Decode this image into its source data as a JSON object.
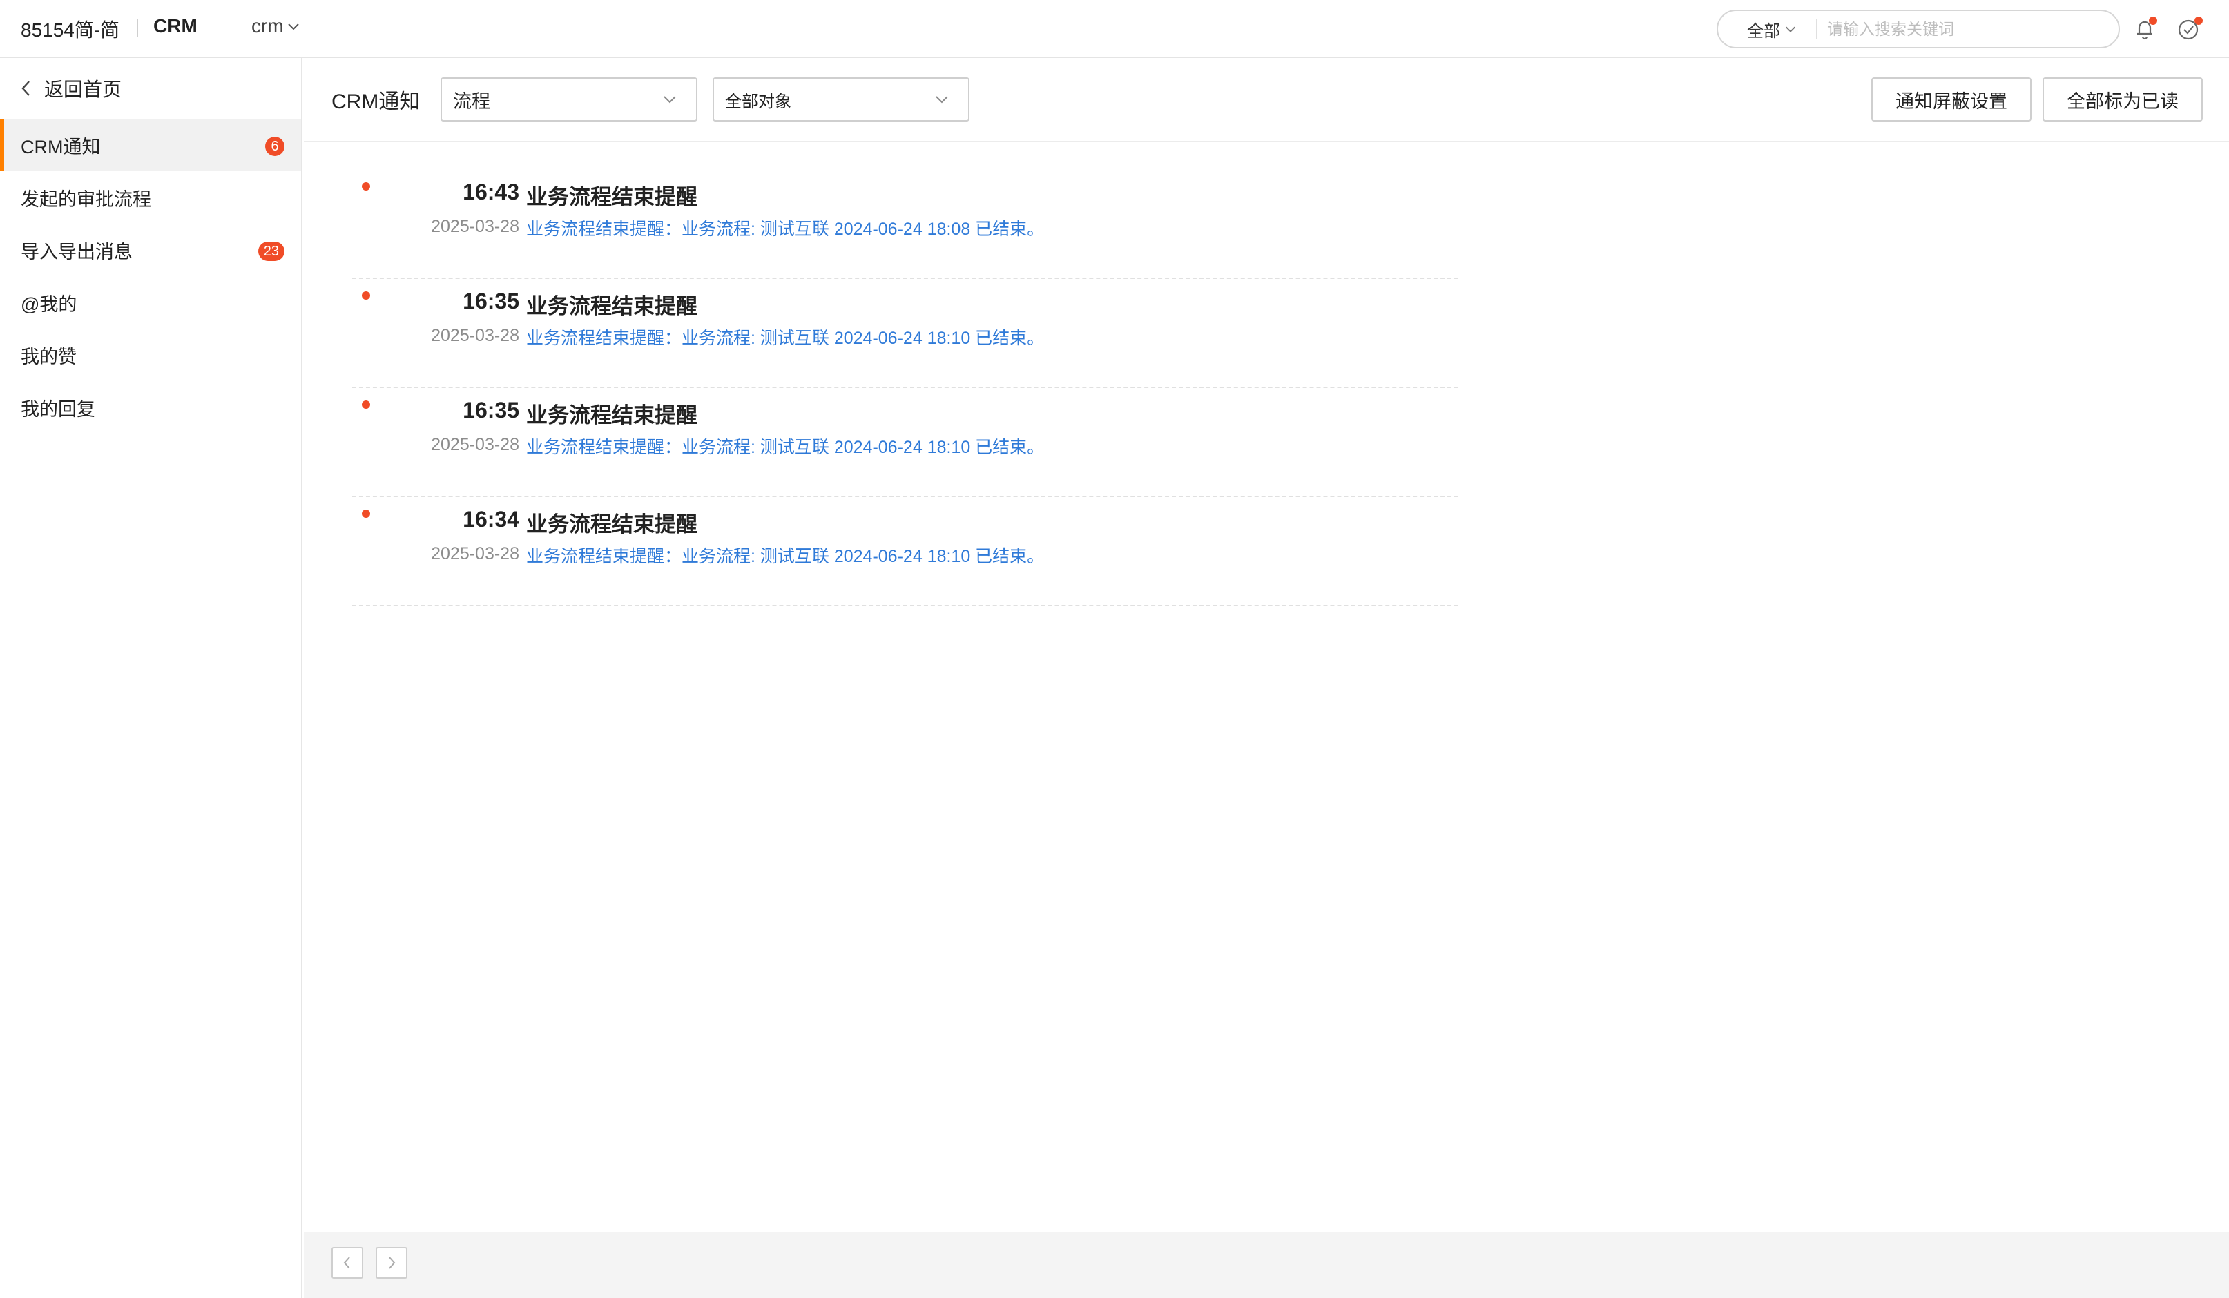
{
  "header": {
    "company": "85154简-简",
    "app_name": "CRM",
    "app_switch": "crm",
    "search": {
      "scope": "全部",
      "placeholder": "请输入搜索关键词"
    },
    "icons": [
      "bell-icon",
      "check-circle-icon"
    ]
  },
  "sidebar": {
    "back_label": "返回首页",
    "items": [
      {
        "label": "CRM通知",
        "badge": "6",
        "active": true
      },
      {
        "label": "发起的审批流程",
        "badge": ""
      },
      {
        "label": "导入导出消息",
        "badge": "23"
      },
      {
        "label": "@我的",
        "badge": ""
      },
      {
        "label": "我的赞",
        "badge": ""
      },
      {
        "label": "我的回复",
        "badge": ""
      }
    ]
  },
  "toolbar": {
    "title": "CRM通知",
    "type_filter": "流程",
    "object_filter": "全部对象",
    "mute_settings_label": "通知屏蔽设置",
    "mark_all_read_label": "全部标为已读"
  },
  "notifications": [
    {
      "time": "16:43",
      "date": "2025-03-28",
      "title": "业务流程结束提醒",
      "message": "业务流程结束提醒：业务流程: 测试互联 2024-06-24 18:08 已结束。",
      "unread": true
    },
    {
      "time": "16:35",
      "date": "2025-03-28",
      "title": "业务流程结束提醒",
      "message": "业务流程结束提醒：业务流程: 测试互联 2024-06-24 18:10 已结束。",
      "unread": true
    },
    {
      "time": "16:35",
      "date": "2025-03-28",
      "title": "业务流程结束提醒",
      "message": "业务流程结束提醒：业务流程: 测试互联 2024-06-24 18:10 已结束。",
      "unread": true
    },
    {
      "time": "16:34",
      "date": "2025-03-28",
      "title": "业务流程结束提醒",
      "message": "业务流程结束提醒：业务流程: 测试互联 2024-06-24 18:10 已结束。",
      "unread": true
    }
  ],
  "colors": {
    "accent": "#ff8000",
    "badge": "#f04c27",
    "link": "#2f7ad8"
  }
}
